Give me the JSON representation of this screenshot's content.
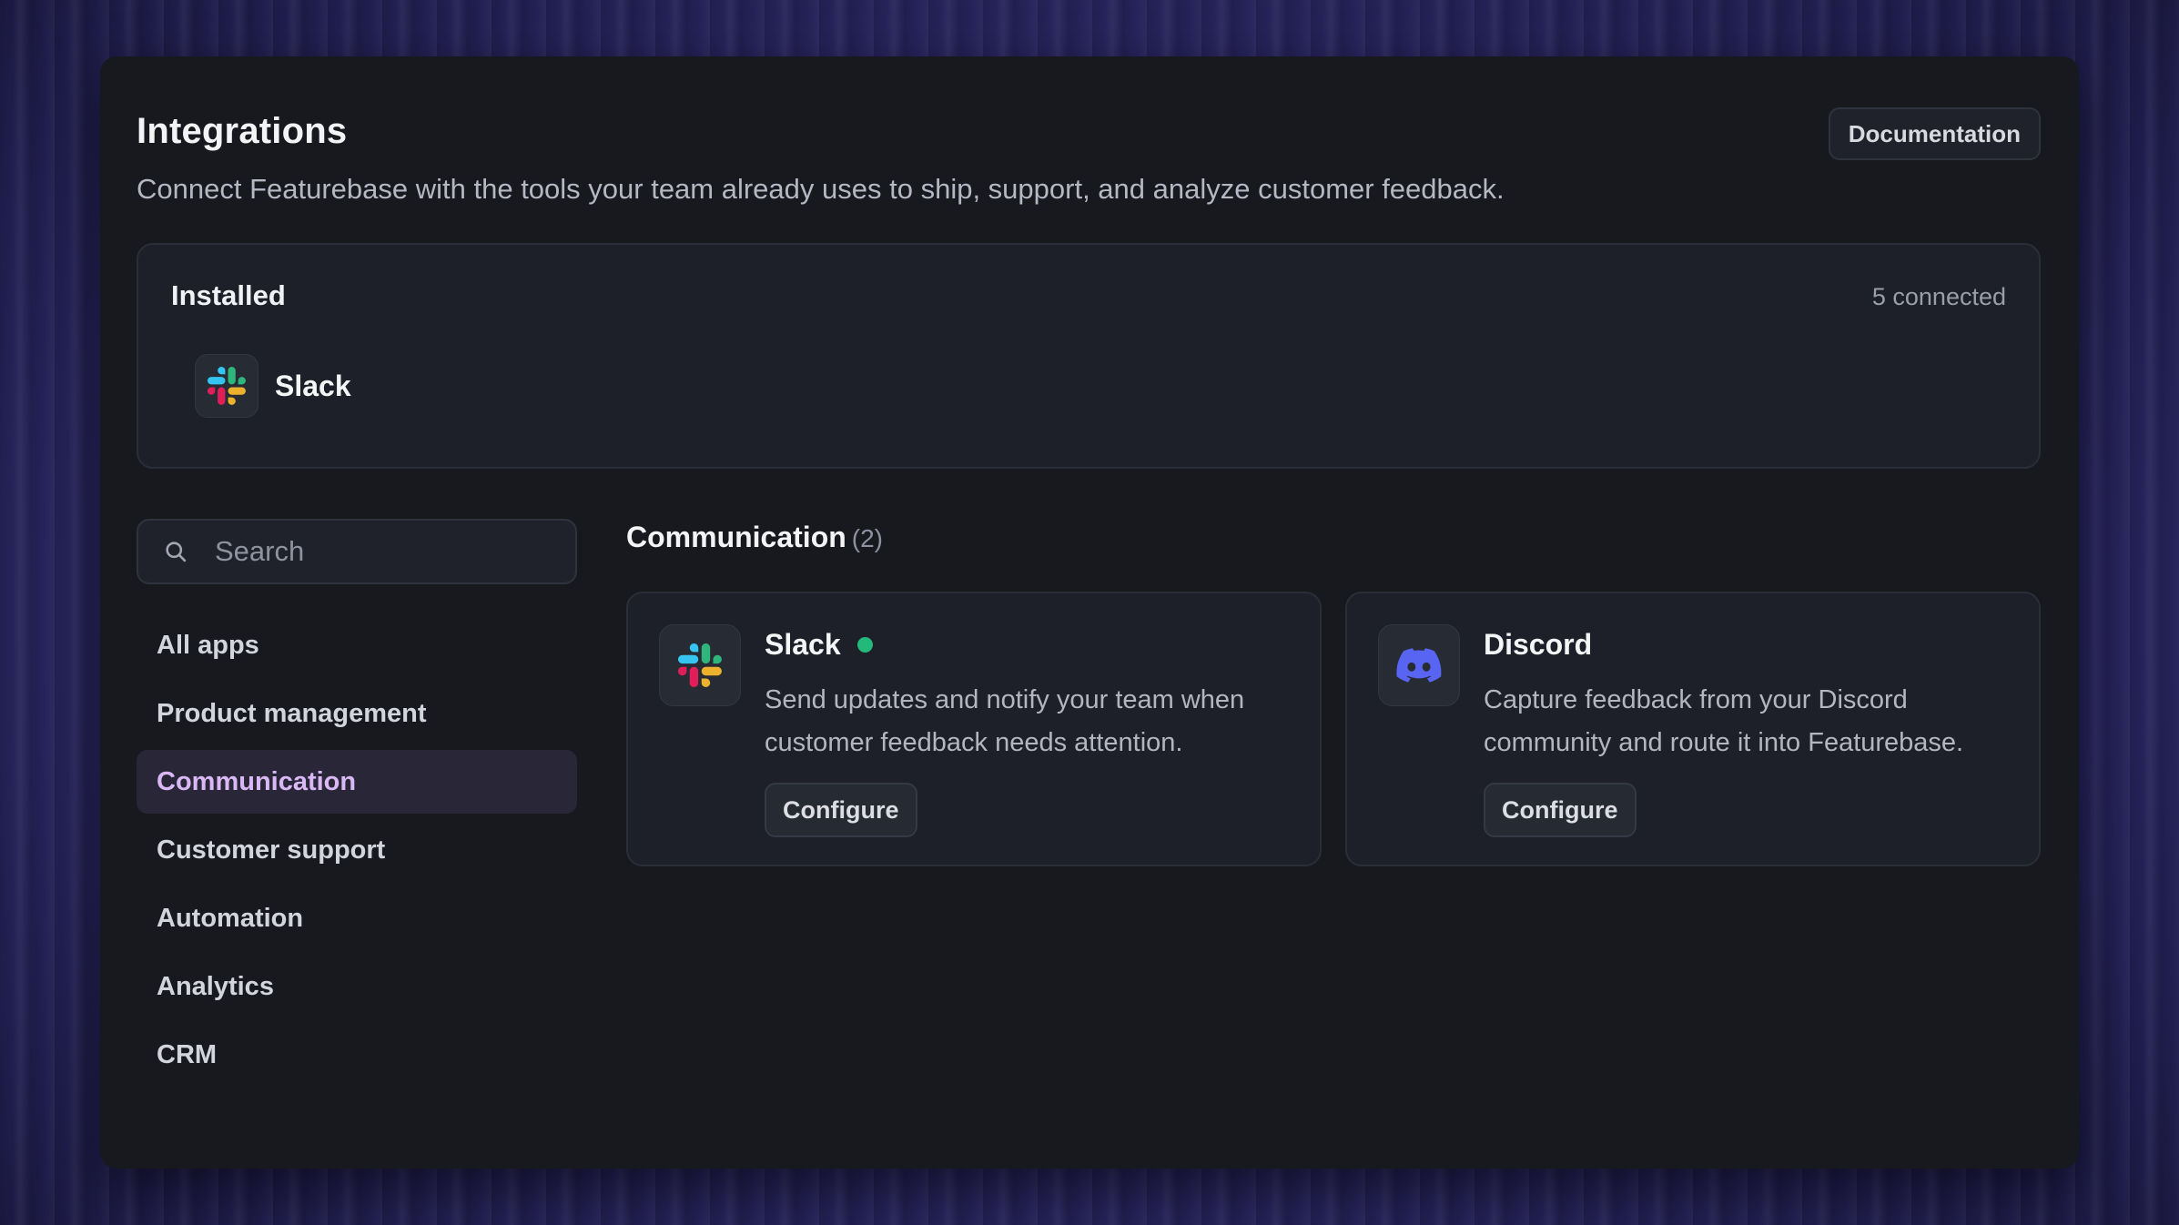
{
  "header": {
    "title": "Integrations",
    "subtitle": "Connect Featurebase with the tools your team already uses to ship, support, and analyze customer feedback.",
    "documentation_label": "Documentation"
  },
  "installed": {
    "title": "Installed",
    "count_label": "5 connected",
    "apps": [
      {
        "name": "Slack",
        "icon": "slack-icon"
      }
    ]
  },
  "search": {
    "placeholder": "Search",
    "value": ""
  },
  "categories": [
    {
      "label": "All apps",
      "active": false
    },
    {
      "label": "Product management",
      "active": false
    },
    {
      "label": "Communication",
      "active": true
    },
    {
      "label": "Customer support",
      "active": false
    },
    {
      "label": "Automation",
      "active": false
    },
    {
      "label": "Analytics",
      "active": false
    },
    {
      "label": "CRM",
      "active": false
    }
  ],
  "section": {
    "title": "Communication",
    "count": "(2)"
  },
  "apps": [
    {
      "name": "Slack",
      "icon": "slack-icon",
      "connected": true,
      "description": "Send updates and notify your team when customer feedback needs attention.",
      "action_label": "Configure"
    },
    {
      "name": "Discord",
      "icon": "discord-icon",
      "connected": false,
      "description": "Capture feedback from your Discord community and route it into Featurebase.",
      "action_label": "Configure"
    }
  ],
  "colors": {
    "panel_bg": "#17191f",
    "card_bg": "#1d2028",
    "accent_active_text": "#d9b8f5",
    "status_connected": "#22b97a",
    "discord_brand": "#5865f2"
  }
}
